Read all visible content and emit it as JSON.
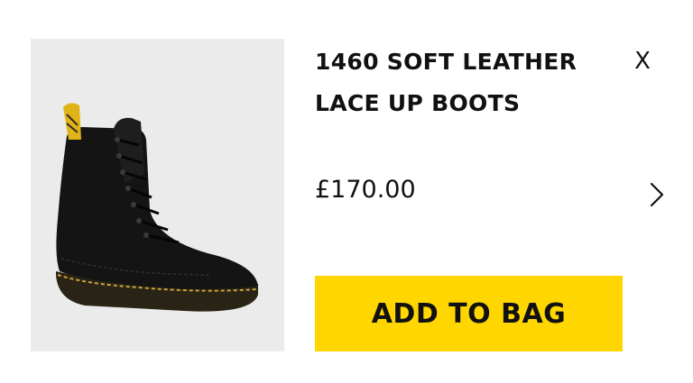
{
  "product": {
    "title": "1460 SOFT LEATHER LACE UP BOOTS",
    "price": "£170.00",
    "image_icon": "boot-product-image"
  },
  "controls": {
    "close_label": "X",
    "next_icon": "chevron-right-icon",
    "add_to_bag_label": "ADD TO BAG"
  },
  "colors": {
    "accent": "#ffd600",
    "image_background": "#ebebeb",
    "text": "#111111"
  }
}
